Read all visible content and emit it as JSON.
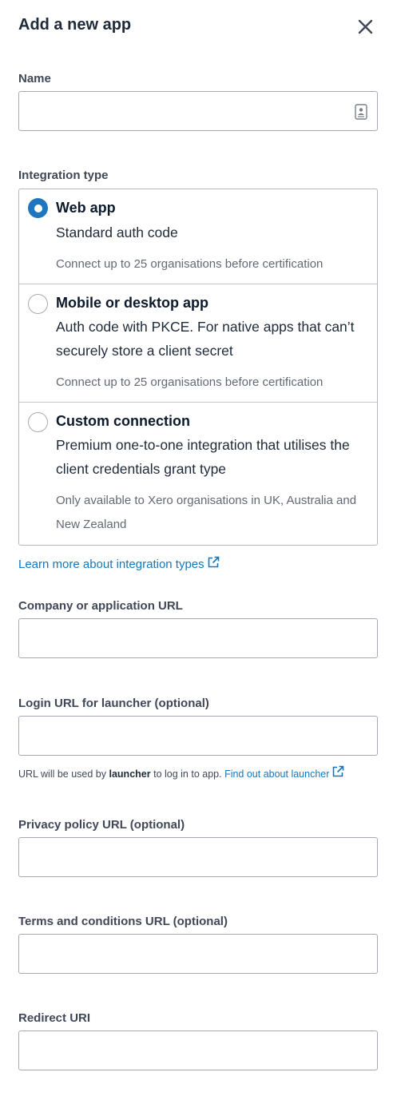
{
  "header": {
    "title": "Add a new app"
  },
  "fields": {
    "name": {
      "label": "Name",
      "value": "",
      "placeholder": ""
    },
    "company_url": {
      "label": "Company or application URL",
      "value": "",
      "placeholder": ""
    },
    "login_url": {
      "label": "Login URL for launcher (optional)",
      "value": "",
      "placeholder": ""
    },
    "privacy_url": {
      "label": "Privacy policy URL (optional)",
      "value": "",
      "placeholder": ""
    },
    "terms_url": {
      "label": "Terms and conditions URL (optional)",
      "value": "",
      "placeholder": ""
    },
    "redirect_uri": {
      "label": "Redirect URI",
      "value": "",
      "placeholder": ""
    }
  },
  "integration": {
    "label": "Integration type",
    "selected": "web-app",
    "options": [
      {
        "id": "web-app",
        "title": "Web app",
        "description": "Standard auth code",
        "note": "Connect up to 25 organisations before certification"
      },
      {
        "id": "mobile-desktop",
        "title": "Mobile or desktop app",
        "description": "Auth code with PKCE. For native apps that can’t securely store a client secret",
        "note": "Connect up to 25 organisations before certification"
      },
      {
        "id": "custom-connection",
        "title": "Custom connection",
        "description": "Premium one-to-one integration that utilises the client credentials grant type",
        "note": "Only available to Xero organisations in UK, Australia and New Zealand"
      }
    ],
    "learn_more": "Learn more about integration types"
  },
  "launcher_help": {
    "prefix": "URL will be used by",
    "bold": "launcher",
    "suffix": "to log in to app.",
    "link": "Find out about launcher"
  },
  "colors": {
    "accent": "#1d76bf",
    "link": "#1477bd",
    "text": "#1e2a38",
    "border": "#a6abb3"
  },
  "icons": [
    "close-icon",
    "contact-card-icon",
    "external-link-icon"
  ]
}
